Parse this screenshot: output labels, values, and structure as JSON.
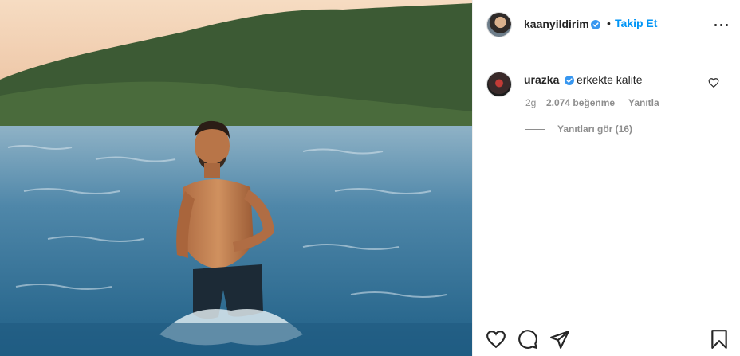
{
  "post": {
    "owner": {
      "username": "kaanyildirim",
      "verified": true,
      "separator": "•",
      "follow_label": "Takip Et"
    },
    "comment": {
      "username": "urazka",
      "verified": true,
      "text": "erkekte kalite",
      "time": "2g",
      "likes": "2.074 beğenme",
      "reply_label": "Yanıtla",
      "view_replies": "Yanıtları gör (16)"
    },
    "icons": {
      "more": "more-options-icon",
      "comment_like": "heart-icon",
      "like": "heart-icon",
      "comment": "comment-bubble-icon",
      "share": "paper-plane-icon",
      "save": "bookmark-icon",
      "verified": "verified-badge-icon"
    },
    "colors": {
      "accent": "#0095f6",
      "text": "#262626",
      "secondary": "#8e8e8e",
      "border": "#efefef"
    }
  }
}
